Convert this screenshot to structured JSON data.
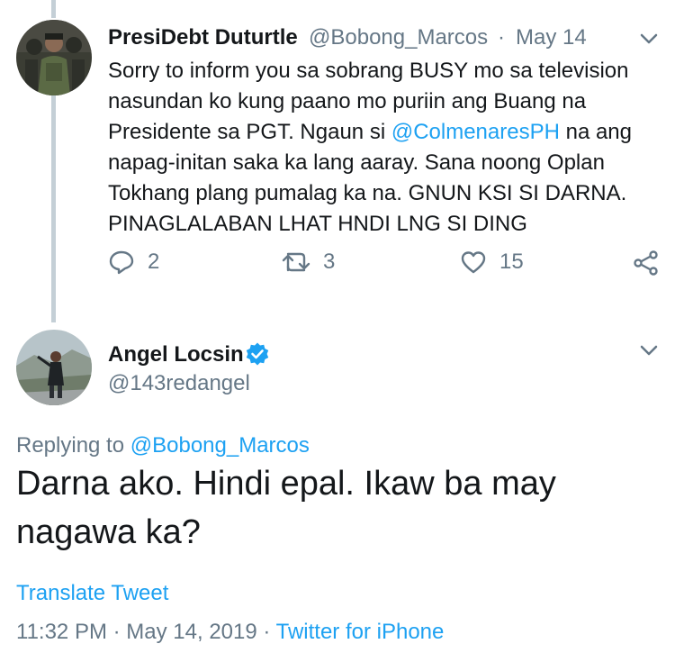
{
  "tweet1": {
    "display_name": "PresiDebt Duturtle",
    "handle": "@Bobong_Marcos",
    "separator": "·",
    "date": "May 14",
    "text_before_mention": "Sorry to inform you sa sobrang BUSY mo sa television nasundan ko kung paano mo puriin ang Buang na Presidente sa PGT. Ngaun si ",
    "mention": "@ColmenaresPH",
    "text_after_mention": " na ang napag-initan saka ka lang aaray. Sana noong Oplan Tokhang plang pumalag ka na. GNUN KSI SI DARNA. PINAGLALABAN LHAT HNDI LNG SI DING",
    "reply_count": "2",
    "retweet_count": "3",
    "like_count": "15",
    "icons": [
      "reply-icon",
      "retweet-icon",
      "like-icon",
      "share-icon",
      "chevron-down-icon"
    ]
  },
  "tweet2": {
    "display_name": "Angel Locsin",
    "handle": "@143redangel",
    "replying_prefix": "Replying to ",
    "replying_to": "@Bobong_Marcos",
    "text": "Darna ako. Hindi epal. Ikaw ba may nagawa ka?",
    "translate": "Translate Tweet",
    "time": "11:32 PM",
    "separator": " · ",
    "full_date": "May 14, 2019",
    "source": "Twitter for iPhone",
    "icons": [
      "verified-badge-icon",
      "chevron-down-icon"
    ]
  },
  "colors": {
    "accent": "#1da1f2",
    "muted": "#657786",
    "text": "#14171a",
    "thread_line": "#c4cfd6"
  }
}
